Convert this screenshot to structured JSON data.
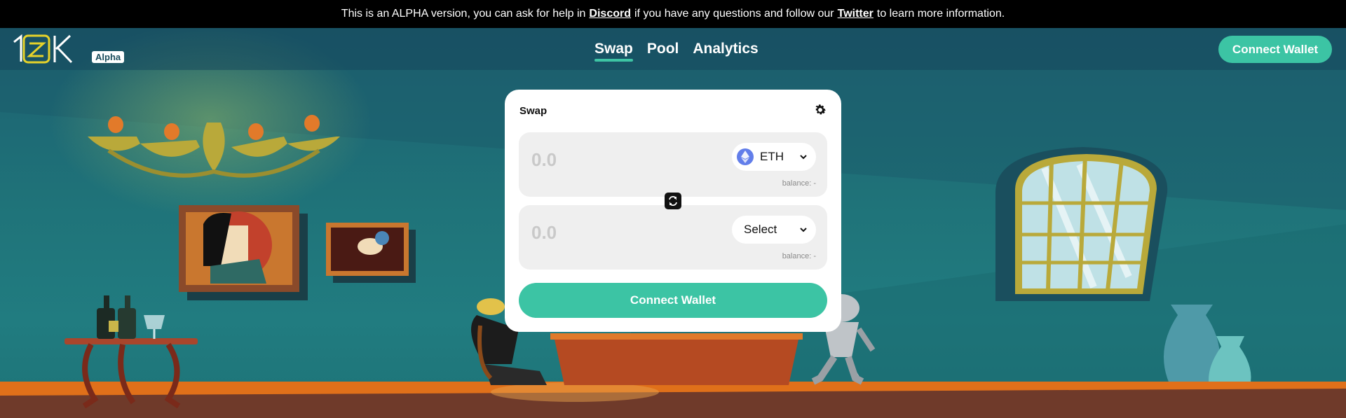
{
  "banner": {
    "text_before": "This is an ALPHA version, you can ask for help in",
    "discord_link": "Discord",
    "text_middle": "if you have any questions and follow our",
    "twitter_link": "Twitter",
    "text_after": "to learn more information."
  },
  "header": {
    "logo_text": "10K",
    "badge": "Alpha",
    "nav": [
      {
        "label": "Swap",
        "active": true
      },
      {
        "label": "Pool",
        "active": false
      },
      {
        "label": "Analytics",
        "active": false
      }
    ],
    "connect_label": "Connect Wallet"
  },
  "swap": {
    "title": "Swap",
    "from": {
      "placeholder": "0.0",
      "token": "ETH",
      "token_icon": "ethereum-icon",
      "balance": "balance: -"
    },
    "to": {
      "placeholder": "0.0",
      "token": "Select",
      "balance": "balance: -"
    },
    "connect_label": "Connect Wallet"
  },
  "colors": {
    "accent": "#3cc4a4",
    "banner_bg": "#000000",
    "scene_bg": "#1f7379",
    "floor": "#e0701a",
    "eth": "#627eea"
  },
  "icons": [
    "gear-icon",
    "swap-direction-icon",
    "chevron-down-icon",
    "ethereum-icon"
  ]
}
